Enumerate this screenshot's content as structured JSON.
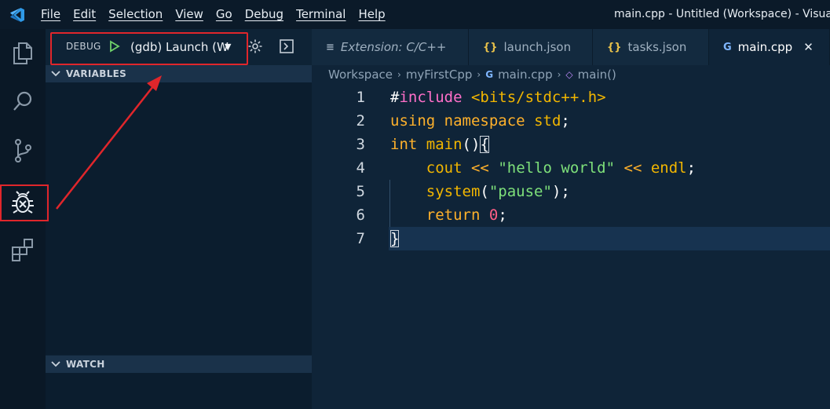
{
  "menu": {
    "items": [
      "File",
      "Edit",
      "Selection",
      "View",
      "Go",
      "Debug",
      "Terminal",
      "Help"
    ],
    "window_title": "main.cpp - Untitled (Workspace) - Visual S"
  },
  "activity_bar": {
    "items": [
      "explorer-icon",
      "search-icon",
      "source-control-icon",
      "debug-icon",
      "extensions-icon"
    ],
    "active": "debug-icon"
  },
  "sidebar": {
    "debug_label": "DEBUG",
    "launch_config": "(gdb) Launch (W",
    "variables_header": "VARIABLES",
    "watch_header": "WATCH"
  },
  "tabs": [
    {
      "label": "Extension: C/C++",
      "icon": "≡",
      "active": false,
      "italic": true
    },
    {
      "label": "launch.json",
      "icon": "{}",
      "active": false,
      "italic": false
    },
    {
      "label": "tasks.json",
      "icon": "{}",
      "active": false,
      "italic": false
    },
    {
      "label": "main.cpp",
      "icon": "G",
      "active": true,
      "italic": false
    }
  ],
  "breadcrumb": {
    "parts": [
      "Workspace",
      "myFirstCpp",
      "main.cpp",
      "main()"
    ]
  },
  "code": {
    "line_numbers": [
      "1",
      "2",
      "3",
      "4",
      "5",
      "6",
      "7"
    ],
    "lines": [
      [
        {
          "t": "#",
          "c": "plain"
        },
        {
          "t": "include",
          "c": "kw-purple"
        },
        {
          "t": " ",
          "c": "plain"
        },
        {
          "t": "<bits/stdc++.h>",
          "c": "kw-gold"
        }
      ],
      [
        {
          "t": "using",
          "c": "kw-orange"
        },
        {
          "t": " ",
          "c": "plain"
        },
        {
          "t": "namespace",
          "c": "kw-orange"
        },
        {
          "t": " ",
          "c": "plain"
        },
        {
          "t": "std",
          "c": "kw-gold"
        },
        {
          "t": ";",
          "c": "plain"
        }
      ],
      [
        {
          "t": "int",
          "c": "kw-orange"
        },
        {
          "t": " ",
          "c": "plain"
        },
        {
          "t": "main",
          "c": "kw-gold"
        },
        {
          "t": "()",
          "c": "plain"
        },
        {
          "t": "{",
          "c": "plain bracket"
        }
      ],
      [
        {
          "t": "    ",
          "c": "plain"
        },
        {
          "t": "cout",
          "c": "kw-gold"
        },
        {
          "t": " ",
          "c": "plain"
        },
        {
          "t": "<<",
          "c": "kw-orange"
        },
        {
          "t": " ",
          "c": "plain"
        },
        {
          "t": "\"hello world\"",
          "c": "str"
        },
        {
          "t": " ",
          "c": "plain"
        },
        {
          "t": "<<",
          "c": "kw-orange"
        },
        {
          "t": " ",
          "c": "plain"
        },
        {
          "t": "endl",
          "c": "kw-gold"
        },
        {
          "t": ";",
          "c": "plain"
        }
      ],
      [
        {
          "t": "    ",
          "c": "plain"
        },
        {
          "t": "system",
          "c": "kw-gold"
        },
        {
          "t": "(",
          "c": "plain"
        },
        {
          "t": "\"pause\"",
          "c": "str"
        },
        {
          "t": ");",
          "c": "plain"
        }
      ],
      [
        {
          "t": "    ",
          "c": "plain"
        },
        {
          "t": "return",
          "c": "kw-orange"
        },
        {
          "t": " ",
          "c": "plain"
        },
        {
          "t": "0",
          "c": "num"
        },
        {
          "t": ";",
          "c": "plain"
        }
      ],
      [
        {
          "t": "}",
          "c": "plain bracket"
        }
      ]
    ]
  },
  "colors": {
    "accent_red": "#e0262b",
    "activity_bg": "#0a1826",
    "editor_bg": "#0f2438"
  }
}
